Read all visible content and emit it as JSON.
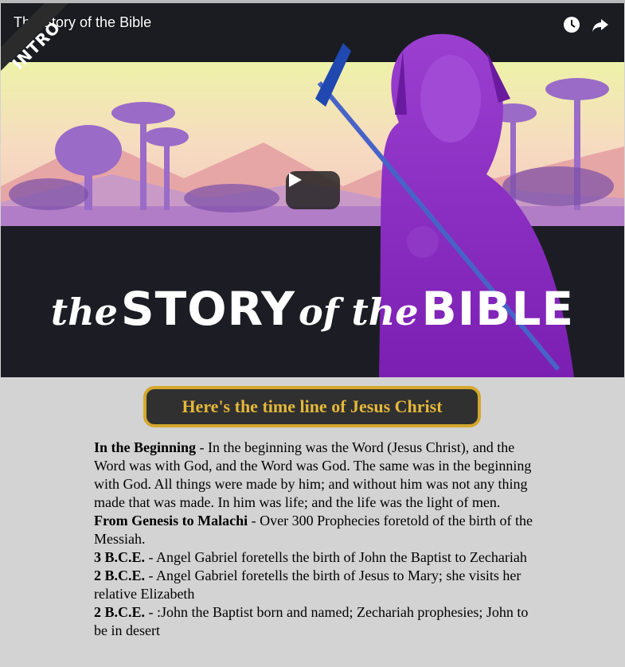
{
  "video": {
    "title": "The Story of the Bible",
    "badge": "INTRO",
    "hero_script_1": "the",
    "hero_block_1": "STORY",
    "hero_script_2": "of the",
    "hero_block_2": "BIBLE",
    "icons": {
      "watch_later": "clock-icon",
      "share": "share-icon",
      "play": "play-icon"
    }
  },
  "timeline_button": {
    "label": "Here's the time line of Jesus Christ"
  },
  "entries": [
    {
      "heading": "In the Beginning",
      "text": " - In the beginning was the Word (Jesus Christ), and the Word was with God, and the Word was God. The same was in the beginning with God. All things were made by him; and without him was not any thing made that was made. In him was life; and the life was the light of men."
    },
    {
      "heading": "From Genesis to Malachi",
      "text": " - Over 300 Prophecies foretold of the birth of the Messiah."
    },
    {
      "heading": "3 B.C.E.",
      "text": " - Angel Gabriel foretells the birth of John the Baptist to Zechariah"
    },
    {
      "heading": "2 B.C.E.",
      "text": " - Angel Gabriel foretells the birth of Jesus to Mary; she visits her relative Elizabeth"
    },
    {
      "heading": "2 B.C.E.",
      "text": " - :John the Baptist born and named; Zechariah prophesies; John to be in desert"
    }
  ],
  "colors": {
    "button_bg": "#303030",
    "button_border": "#d4a72c",
    "button_text": "#e5b83b",
    "page_bg": "#d3d3d3"
  }
}
